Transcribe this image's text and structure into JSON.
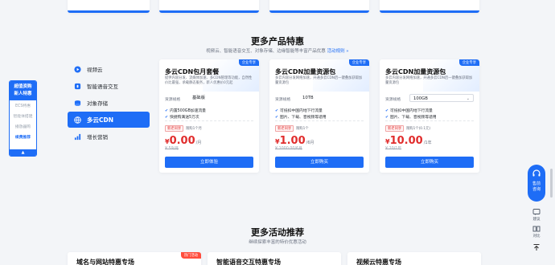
{
  "section": {
    "title": "更多产品特惠",
    "subtitle": "视频云、智能语音交互、对象存储、边缘智能等丰富产品优惠",
    "rules_link": "活动规则 »"
  },
  "promo": {
    "title_line1": "超值资购",
    "title_line2": "新人特惠",
    "items": [
      "ECS特惠",
      "智能体搭建",
      "播放器购",
      "续费推荐"
    ],
    "active_index": 3,
    "collapse_icon": "caret-up-icon"
  },
  "categories": [
    {
      "label": "视频云",
      "icon": "video-cloud-icon"
    },
    {
      "label": "智能语音交互",
      "icon": "voice-icon"
    },
    {
      "label": "对象存储",
      "icon": "storage-icon"
    },
    {
      "label": "多云CDN",
      "icon": "cdn-icon",
      "active": true
    },
    {
      "label": "增长营销",
      "icon": "growth-icon"
    }
  ],
  "products": [
    {
      "badge": "企业专享",
      "name": "多云CDN包月套餐",
      "desc": "提供内容分发、流媒体加速、多CDN管理等功能，自然性价比最强，承载静态服务，新人优惠价0元起",
      "spec_label": "资源规格",
      "spec_value": "基础版",
      "features": [
        "内置500GB加速流量",
        "快捷购满送5万次"
      ],
      "tag": "新老同享",
      "limit": "限购1个月",
      "currency": "¥",
      "price": "0.00",
      "unit": "/月",
      "original": "¥ 59/月",
      "button": "立即体验"
    },
    {
      "badge": "企业专享",
      "name": "多云CDN加量资源包",
      "desc": "多云内容分发网络加速，开通多云CDN后一键叠加获取加量资源包",
      "spec_label": "资源规格",
      "spec_value": "10TB",
      "features": [
        "可抵扣中国内地下行流量",
        "图片、下载、音视频等适用"
      ],
      "tag": "新老同享",
      "limit": "限购1个",
      "currency": "¥",
      "price": "1.00",
      "unit": "/6月",
      "original": "¥ 1000.00/6月",
      "button": "立即购买"
    },
    {
      "badge": "企业专享",
      "name": "多云CDN加量资源包",
      "desc": "多云内容分发网络加速，开通多云CDN后一键叠加获取加量资源包",
      "spec_label": "资源规格",
      "spec_value": "100GB",
      "features": [
        "可抵扣中国内地下行流量",
        "图片、下载、音视频等适用"
      ],
      "tag": "新老同享",
      "limit": "限购1个(0.1元)",
      "currency": "¥",
      "price": "10.00",
      "unit": "/1年",
      "original": "¥ 20/1年",
      "button": "立即购买"
    }
  ],
  "more": {
    "title": "更多活动推荐",
    "subtitle": "继续探索丰富的特价优惠活动",
    "cards": [
      {
        "title": "域名与网站特惠专场",
        "hot": "热门活动"
      },
      {
        "title": "智能语音交互特惠专场"
      },
      {
        "title": "视频云特惠专场"
      }
    ]
  },
  "float_tools": {
    "consult_line1": "售前",
    "consult_line2": "咨询",
    "feedback": "建议",
    "compare": "对比",
    "top_icon": "arrow-up-icon"
  },
  "colors": {
    "accent": "#1e6df6",
    "price": "#e12d2d",
    "hot": "#ff4d3d"
  }
}
